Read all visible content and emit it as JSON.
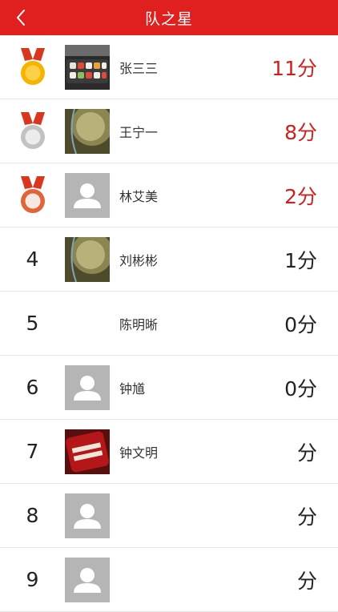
{
  "header": {
    "title": "队之星",
    "back_icon": "chevron-left-icon"
  },
  "colors": {
    "navbar_bg": "#e0201f",
    "top_score": "#cc1f1f",
    "gold": "#f5b400",
    "silver": "#c2c2c2",
    "bronze": "#e0643c",
    "ribbon": "#d9361f"
  },
  "ranking": [
    {
      "rank": "1",
      "medal": "gold-medal-icon",
      "avatar": "food-photo",
      "name": "张三三",
      "score": "11",
      "unit": "分"
    },
    {
      "rank": "2",
      "medal": "silver-medal-icon",
      "avatar": "photo-dark",
      "name": "王宁一",
      "score": "8",
      "unit": "分"
    },
    {
      "rank": "3",
      "medal": "bronze-medal-icon",
      "avatar": "default-user",
      "name": "林艾美",
      "score": "2",
      "unit": "分"
    },
    {
      "rank": "4",
      "medal": "",
      "avatar": "photo-dark",
      "name": "刘彬彬",
      "score": "1",
      "unit": "分"
    },
    {
      "rank": "5",
      "medal": "",
      "avatar": "none",
      "name": "陈明晰",
      "score": "0",
      "unit": "分"
    },
    {
      "rank": "6",
      "medal": "",
      "avatar": "default-user",
      "name": "钟馗",
      "score": "0",
      "unit": "分"
    },
    {
      "rank": "7",
      "medal": "",
      "avatar": "poster-photo",
      "name": "钟文明",
      "score": "",
      "unit": "分"
    },
    {
      "rank": "8",
      "medal": "",
      "avatar": "default-user",
      "name": "",
      "score": "",
      "unit": "分"
    },
    {
      "rank": "9",
      "medal": "",
      "avatar": "default-user",
      "name": "",
      "score": "",
      "unit": "分"
    }
  ]
}
